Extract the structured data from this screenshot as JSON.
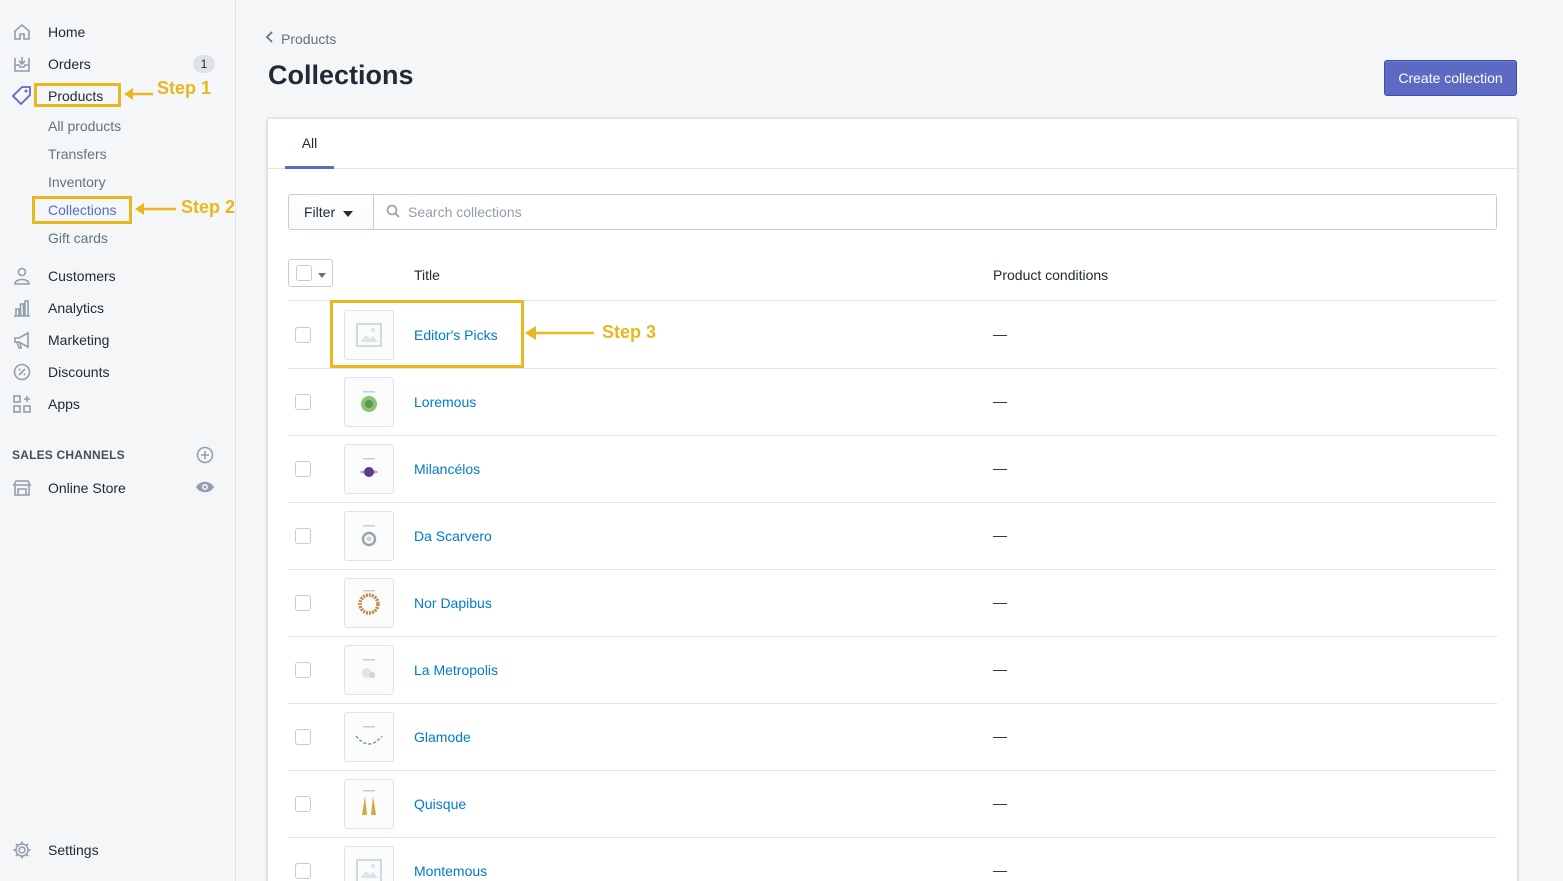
{
  "sidebar": {
    "home": "Home",
    "orders": "Orders",
    "orders_badge": "1",
    "products": "Products",
    "sub": {
      "all_products": "All products",
      "transfers": "Transfers",
      "inventory": "Inventory",
      "collections": "Collections",
      "gift_cards": "Gift cards"
    },
    "customers": "Customers",
    "analytics": "Analytics",
    "marketing": "Marketing",
    "discounts": "Discounts",
    "apps": "Apps",
    "sales_channels_title": "SALES CHANNELS",
    "online_store": "Online Store",
    "settings": "Settings"
  },
  "annotations": {
    "step1": "Step 1",
    "step2": "Step 2",
    "step3": "Step 3",
    "color": "#e8b81e"
  },
  "header": {
    "breadcrumb": "Products",
    "title": "Collections",
    "create_button": "Create collection"
  },
  "tabs": [
    "All"
  ],
  "filter": {
    "button": "Filter",
    "search_placeholder": "Search collections"
  },
  "table": {
    "col_title": "Title",
    "col_conditions": "Product conditions",
    "rows": [
      {
        "title": "Editor's Picks",
        "conditions": "—",
        "thumb": "placeholder"
      },
      {
        "title": "Loremous",
        "conditions": "—",
        "thumb": "green-gem"
      },
      {
        "title": "Milancélos",
        "conditions": "—",
        "thumb": "purple-gem"
      },
      {
        "title": "Da Scarvero",
        "conditions": "—",
        "thumb": "silver-ring"
      },
      {
        "title": "Nor Dapibus",
        "conditions": "—",
        "thumb": "bead-bracelet"
      },
      {
        "title": "La Metropolis",
        "conditions": "—",
        "thumb": "pearl"
      },
      {
        "title": "Glamode",
        "conditions": "—",
        "thumb": "leaf-wreath"
      },
      {
        "title": "Quisque",
        "conditions": "—",
        "thumb": "gold-earrings"
      },
      {
        "title": "Montemous",
        "conditions": "—",
        "thumb": "placeholder"
      }
    ]
  },
  "colors": {
    "accent": "#5c6ac4",
    "link": "#007ace"
  }
}
